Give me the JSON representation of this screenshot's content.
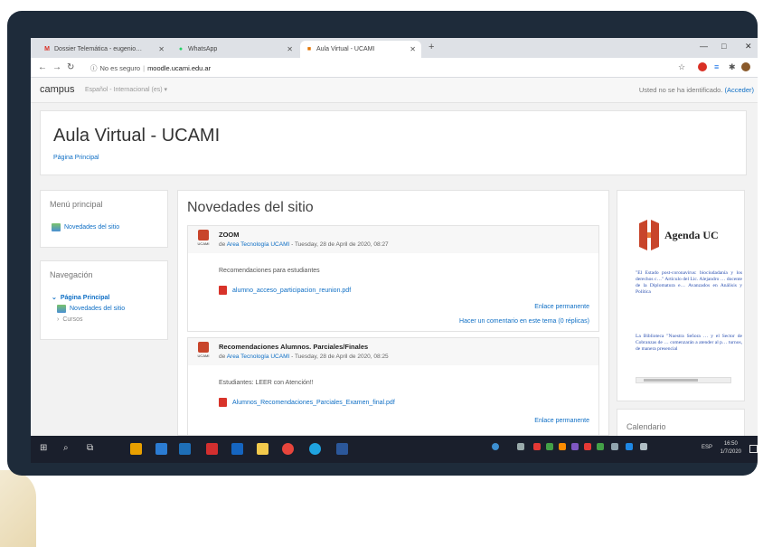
{
  "browser": {
    "tabs": [
      {
        "label": "Dossier Telemática - eugenio…",
        "favicon": "M",
        "color": "#d93025"
      },
      {
        "label": "WhatsApp",
        "favicon": "●",
        "color": "#25d366"
      },
      {
        "label": "Aula Virtual - UCAMI",
        "favicon": "■",
        "color": "#e37400"
      }
    ],
    "new_tab": "+",
    "url": {
      "security": "No es seguro",
      "host": "moodle.ucami.edu.ar"
    }
  },
  "moodle_nav": {
    "brand": "campus",
    "language": "Español - Internacional (es) ▾",
    "login_text": "Usted no se ha identificado.",
    "login_link": "(Acceder)"
  },
  "header": {
    "site_title": "Aula Virtual - UCAMI",
    "breadcrumb": "Página Principal"
  },
  "main_menu": {
    "title": "Menú principal",
    "items": [
      "Novedades del sitio"
    ]
  },
  "navigation": {
    "title": "Navegación",
    "items": [
      "Página Principal",
      "Novedades del sitio",
      "Cursos"
    ]
  },
  "news": {
    "title": "Novedades del sitio",
    "posts": [
      {
        "avatar_label": "UCAMI",
        "subject": "ZOOM",
        "by": "de",
        "author": "Area Tecnología UCAMI",
        "date": " - Tuesday, 28 de April de 2020, 08:27",
        "body": "Recomendaciones para estudiantes",
        "attachment": "alumno_acceso_participacion_reunion.pdf",
        "permalink": "Enlace permanente",
        "comment": "Hacer un comentario en este tema (0 réplicas)"
      },
      {
        "avatar_label": "UCAMI",
        "subject": "Recomendaciones Alumnos. Parciales/Finales",
        "by": "de",
        "author": "Area Tecnología UCAMI",
        "date": " - Tuesday, 28 de April de 2020, 08:25",
        "body": "Estudiantes: LEER con Atención!!",
        "attachment": "Alumnos_Recomendaciones_Parciales_Examen_final.pdf",
        "permalink": "Enlace permanente"
      }
    ]
  },
  "agenda": {
    "title": "Agenda UC",
    "text1": "\"El Estado post-coronavirus: biociudadanía y los derechos c…\" Artículo del Lic. Alejandro … docente de la Diplomatura e… Avanzados en Análisis y Política",
    "text2": "La Biblioteca \"Nuestra Señora … y el Sector de Cobranzas de … comenzarán a atender al p… turnos, de manera presencial"
  },
  "calendar": {
    "title": "Calendario"
  },
  "taskbar": {
    "time": "16:50",
    "date": "1/7/2020",
    "lang": "ESP"
  },
  "colors": {
    "link": "#0f6fc5",
    "frame": "#1e2b3a",
    "taskbar": "#1a1f2c"
  }
}
